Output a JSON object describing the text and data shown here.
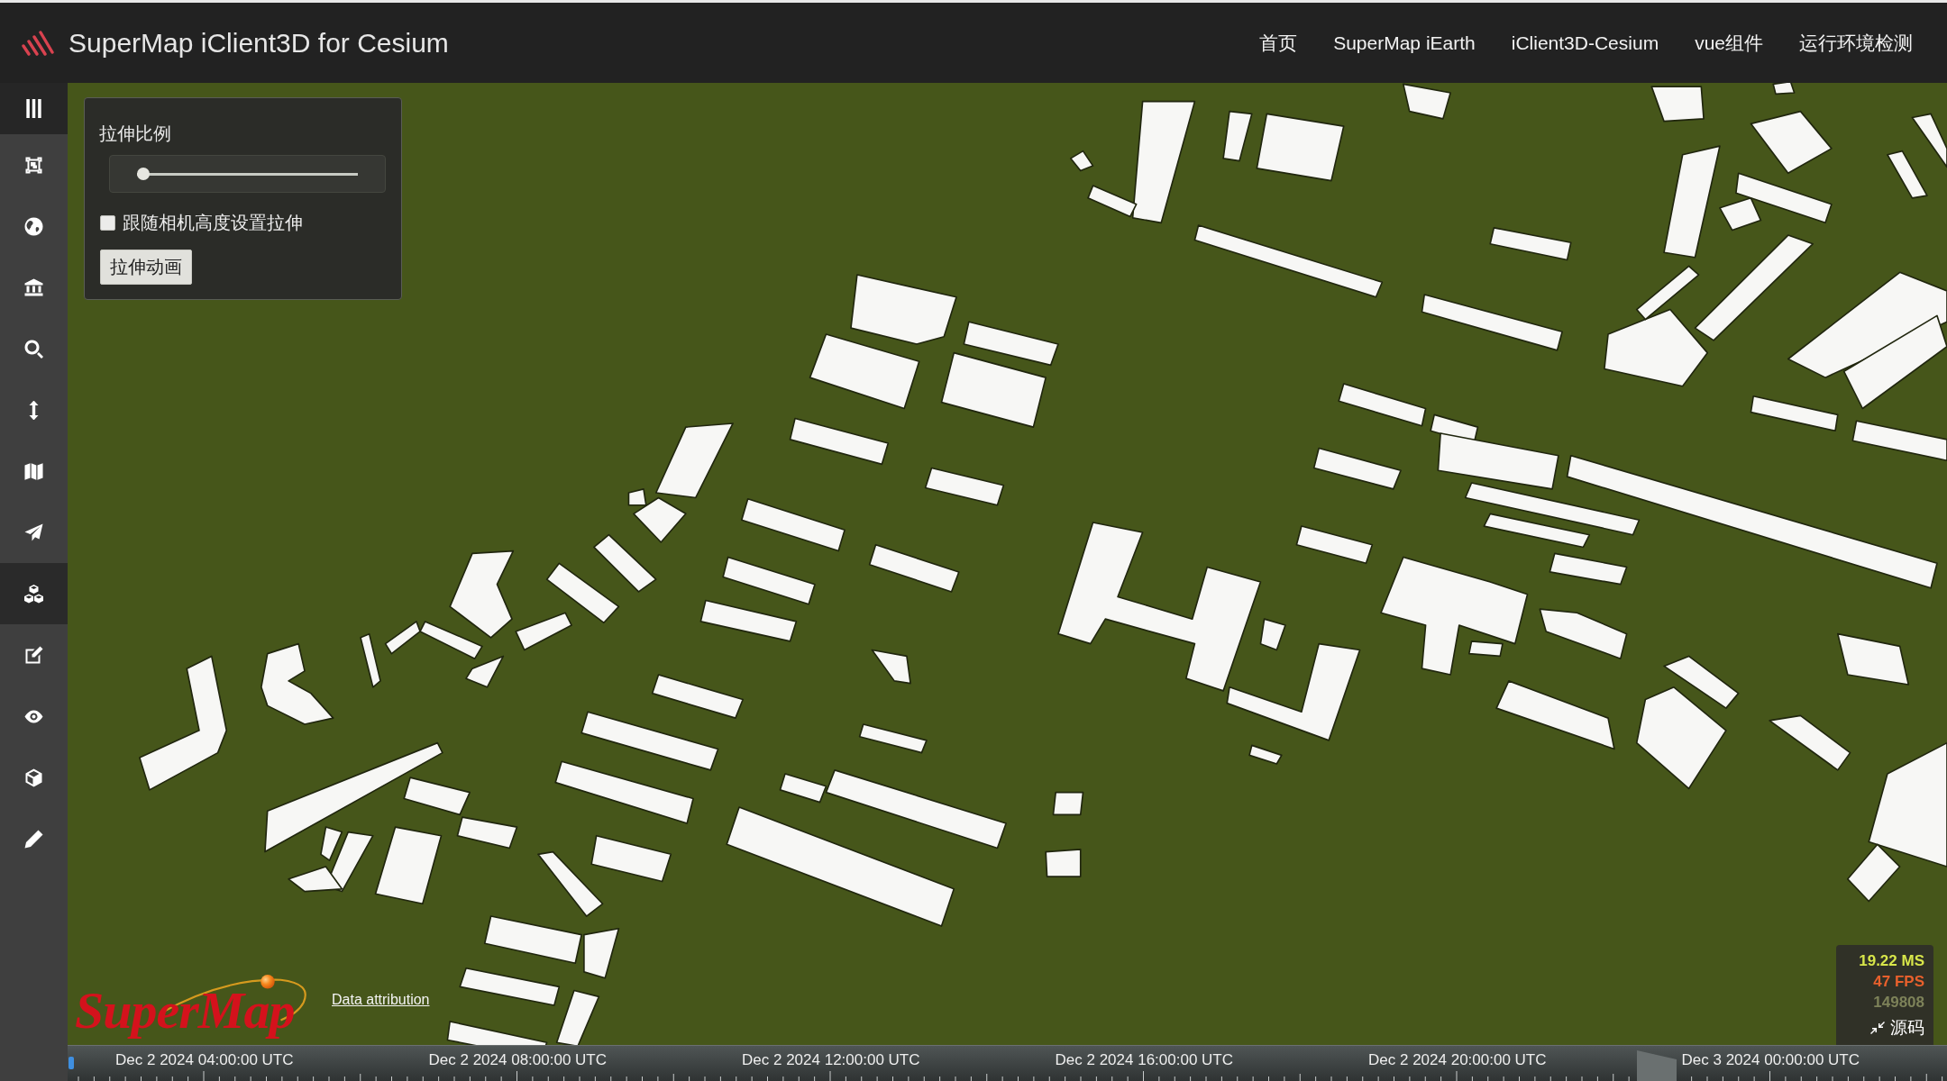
{
  "header": {
    "title": "SuperMap iClient3D for Cesium",
    "nav": [
      "首页",
      "SuperMap iEarth",
      "iClient3D-Cesium",
      "vue组件",
      "运行环境检测"
    ]
  },
  "sidebar": {
    "items": [
      {
        "selected": false
      },
      {
        "selected": false
      },
      {
        "selected": false
      },
      {
        "selected": false
      },
      {
        "selected": false
      },
      {
        "selected": false
      },
      {
        "selected": false
      },
      {
        "selected": true
      },
      {
        "selected": false
      },
      {
        "selected": false
      },
      {
        "selected": false
      },
      {
        "selected": false
      }
    ]
  },
  "panel": {
    "slider": {
      "label": "拉伸比例",
      "level": 0
    },
    "checkbox": {
      "label": "跟随相机高度设置拉伸",
      "checked": false
    },
    "button": "拉伸动画"
  },
  "map": {
    "logo": "SuperMap",
    "attribution": "Data attribution"
  },
  "performance": {
    "frame_time": "19.22 MS",
    "fps": "47 FPS",
    "count": "149808",
    "source_button": "源码"
  },
  "timeline": {
    "labels": [
      "Dec 2 2024 04:00:00 UTC",
      "Dec 2 2024 08:00:00 UTC",
      "Dec 2 2024 12:00:00 UTC",
      "Dec 2 2024 16:00:00 UTC",
      "Dec 2 2024 20:00:00 UTC",
      "Dec 3 2024 00:00:00 UTC"
    ]
  }
}
